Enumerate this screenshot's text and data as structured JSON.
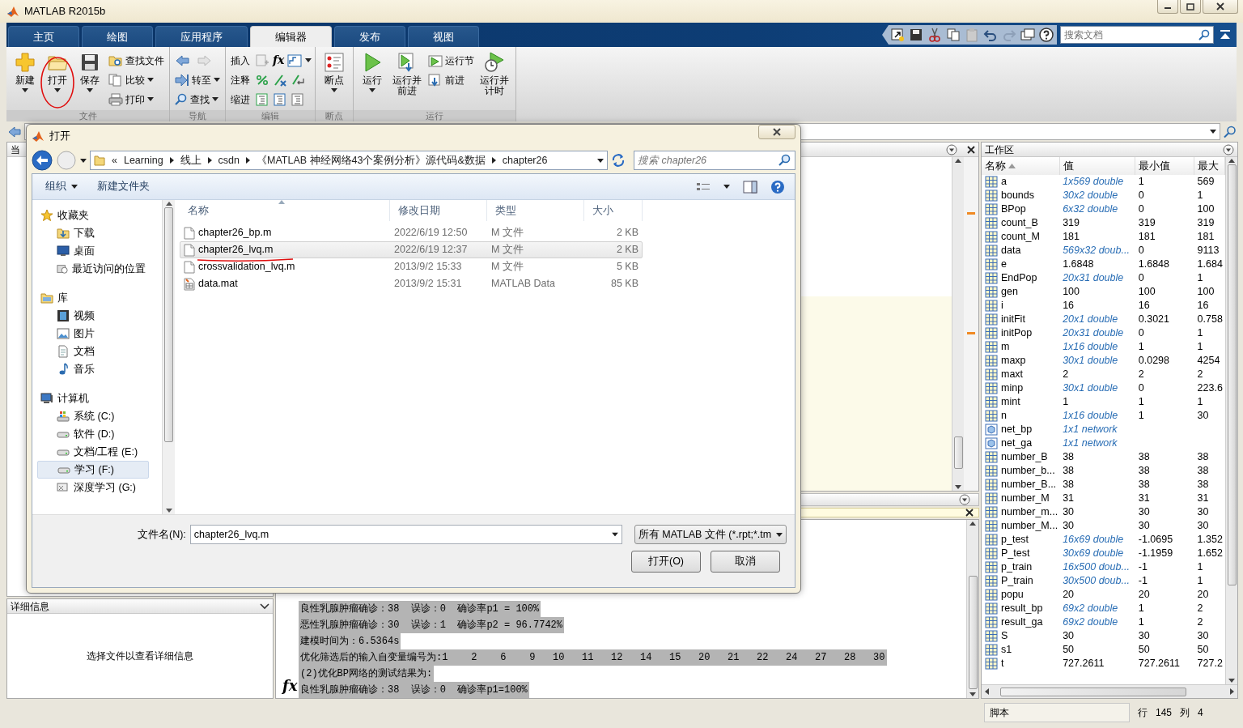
{
  "window": {
    "title": "MATLAB R2015b"
  },
  "tabs": [
    {
      "label": "主页",
      "selected": false
    },
    {
      "label": "绘图",
      "selected": false
    },
    {
      "label": "应用程序",
      "selected": false
    },
    {
      "label": "编辑器",
      "selected": true
    },
    {
      "label": "发布",
      "selected": false
    },
    {
      "label": "视图",
      "selected": false
    }
  ],
  "doc_search": {
    "placeholder": "搜索文档"
  },
  "ribbon": {
    "groups": [
      {
        "label": "文件",
        "items": [
          {
            "kind": "large",
            "label": "新建",
            "menu": true
          },
          {
            "kind": "large",
            "label": "打开",
            "menu": true
          },
          {
            "kind": "large",
            "label": "保存",
            "menu": true
          },
          {
            "kind": "small",
            "label": "查找文件",
            "menu": false
          },
          {
            "kind": "small",
            "label": "比较",
            "menu": true
          },
          {
            "kind": "small",
            "label": "打印",
            "menu": true
          }
        ]
      },
      {
        "label": "导航",
        "items": [
          {
            "kind": "small",
            "menu": false
          },
          {
            "kind": "small",
            "label": "转至",
            "menu": true
          },
          {
            "kind": "small",
            "label": "查找",
            "menu": true
          }
        ]
      },
      {
        "label": "编辑",
        "items": [
          {
            "kind": "small",
            "label": "插入",
            "glyph": "fx",
            "menu": true
          },
          {
            "kind": "small",
            "label": "注释",
            "menu": false
          },
          {
            "kind": "small",
            "label": "缩进",
            "menu": false
          }
        ]
      },
      {
        "label": "断点",
        "items": [
          {
            "kind": "large",
            "label": "断点",
            "menu": true
          }
        ]
      },
      {
        "label": "运行",
        "items": [
          {
            "kind": "large",
            "label": "运行",
            "menu": true
          },
          {
            "kind": "large",
            "label": "运行并前进",
            "menu": false
          },
          {
            "kind": "small",
            "label": "运行节",
            "menu": false
          },
          {
            "kind": "small",
            "label": "前进",
            "menu": false
          },
          {
            "kind": "large",
            "label": "运行并计时",
            "menu": false
          }
        ]
      }
    ]
  },
  "current_folder": {
    "title": "当"
  },
  "details": {
    "title": "详细信息",
    "message": "选择文件以查看详细信息"
  },
  "command_window": {
    "prompt_glyph": "fx",
    "lines": [
      {
        "text": "良性乳腺肿瘤确诊：38  误诊：0  确诊率p1 = 100%",
        "selected": true
      },
      {
        "text": "恶性乳腺肿瘤确诊：30  误诊：1  确诊率p2 = 96.7742%",
        "selected": true
      },
      {
        "text": "建模时间为：6.5364s",
        "selected": true
      },
      {
        "text": "优化筛选后的输入自变量编号为:1    2    6    9   10   11   12   14   15   20   21   22   24   27   28   30",
        "selected": true
      },
      {
        "text": "(2)优化BP网络的测试结果为:",
        "selected": true
      },
      {
        "text": "良性乳腺肿瘤确诊：38  误诊：0  确诊率p1=100%",
        "selected": true
      }
    ]
  },
  "workspace": {
    "title": "工作区",
    "columns": [
      {
        "label": "名称",
        "sorted": true
      },
      {
        "label": "值",
        "sorted": false
      },
      {
        "label": "最小值",
        "sorted": false
      },
      {
        "label": "最大",
        "sorted": false
      }
    ],
    "rows": [
      {
        "name": "a",
        "value": "1x569 double",
        "min": "1",
        "max": "569",
        "kind": "matrix"
      },
      {
        "name": "bounds",
        "value": "30x2 double",
        "min": "0",
        "max": "1",
        "kind": "matrix"
      },
      {
        "name": "BPop",
        "value": "6x32 double",
        "min": "0",
        "max": "100",
        "kind": "matrix"
      },
      {
        "name": "count_B",
        "value": "319",
        "min": "319",
        "max": "319",
        "kind": "scalar"
      },
      {
        "name": "count_M",
        "value": "181",
        "min": "181",
        "max": "181",
        "kind": "scalar"
      },
      {
        "name": "data",
        "value": "569x32 doub...",
        "min": "0",
        "max": "9113",
        "kind": "matrix"
      },
      {
        "name": "e",
        "value": "1.6848",
        "min": "1.6848",
        "max": "1.684",
        "kind": "scalar"
      },
      {
        "name": "EndPop",
        "value": "20x31 double",
        "min": "0",
        "max": "1",
        "kind": "matrix"
      },
      {
        "name": "gen",
        "value": "100",
        "min": "100",
        "max": "100",
        "kind": "scalar"
      },
      {
        "name": "i",
        "value": "16",
        "min": "16",
        "max": "16",
        "kind": "scalar"
      },
      {
        "name": "initFit",
        "value": "20x1 double",
        "min": "0.3021",
        "max": "0.758",
        "kind": "matrix"
      },
      {
        "name": "initPop",
        "value": "20x31 double",
        "min": "0",
        "max": "1",
        "kind": "matrix"
      },
      {
        "name": "m",
        "value": "1x16 double",
        "min": "1",
        "max": "1",
        "kind": "matrix"
      },
      {
        "name": "maxp",
        "value": "30x1 double",
        "min": "0.0298",
        "max": "4254",
        "kind": "matrix"
      },
      {
        "name": "maxt",
        "value": "2",
        "min": "2",
        "max": "2",
        "kind": "scalar"
      },
      {
        "name": "minp",
        "value": "30x1 double",
        "min": "0",
        "max": "223.6",
        "kind": "matrix"
      },
      {
        "name": "mint",
        "value": "1",
        "min": "1",
        "max": "1",
        "kind": "scalar"
      },
      {
        "name": "n",
        "value": "1x16 double",
        "min": "1",
        "max": "30",
        "kind": "matrix"
      },
      {
        "name": "net_bp",
        "value": "1x1 network",
        "kind": "object"
      },
      {
        "name": "net_ga",
        "value": "1x1 network",
        "kind": "object"
      },
      {
        "name": "number_B",
        "value": "38",
        "min": "38",
        "max": "38",
        "kind": "scalar"
      },
      {
        "name": "number_b...",
        "value": "38",
        "min": "38",
        "max": "38",
        "kind": "scalar"
      },
      {
        "name": "number_B...",
        "value": "38",
        "min": "38",
        "max": "38",
        "kind": "scalar"
      },
      {
        "name": "number_M",
        "value": "31",
        "min": "31",
        "max": "31",
        "kind": "scalar"
      },
      {
        "name": "number_m...",
        "value": "30",
        "min": "30",
        "max": "30",
        "kind": "scalar"
      },
      {
        "name": "number_M...",
        "value": "30",
        "min": "30",
        "max": "30",
        "kind": "scalar"
      },
      {
        "name": "p_test",
        "value": "16x69 double",
        "min": "-1.0695",
        "max": "1.352",
        "kind": "matrix"
      },
      {
        "name": "P_test",
        "value": "30x69 double",
        "min": "-1.1959",
        "max": "1.652",
        "kind": "matrix"
      },
      {
        "name": "p_train",
        "value": "16x500 doub...",
        "min": "-1",
        "max": "1",
        "kind": "matrix"
      },
      {
        "name": "P_train",
        "value": "30x500 doub...",
        "min": "-1",
        "max": "1",
        "kind": "matrix"
      },
      {
        "name": "popu",
        "value": "20",
        "min": "20",
        "max": "20",
        "kind": "scalar"
      },
      {
        "name": "result_bp",
        "value": "69x2 double",
        "min": "1",
        "max": "2",
        "kind": "matrix"
      },
      {
        "name": "result_ga",
        "value": "69x2 double",
        "min": "1",
        "max": "2",
        "kind": "matrix"
      },
      {
        "name": "S",
        "value": "30",
        "min": "30",
        "max": "30",
        "kind": "scalar"
      },
      {
        "name": "s1",
        "value": "50",
        "min": "50",
        "max": "50",
        "kind": "scalar"
      },
      {
        "name": "t",
        "value": "727.2611",
        "min": "727.2611",
        "max": "727.2",
        "kind": "scalar"
      }
    ]
  },
  "status_bar": {
    "mode": "脚本",
    "line_label": "行",
    "line": "145",
    "col_label": "列",
    "col": "4"
  },
  "dialog": {
    "title": "打开",
    "breadcrumb": [
      {
        "label": "«"
      },
      {
        "label": "Learning"
      },
      {
        "label": "线上"
      },
      {
        "label": "csdn"
      },
      {
        "label": "《MATLAB 神经网络43个案例分析》源代码&数据"
      },
      {
        "label": "chapter26"
      }
    ],
    "search": {
      "placeholder": "搜索 chapter26"
    },
    "toolbar": [
      {
        "label": "组织",
        "menu": true
      },
      {
        "label": "新建文件夹",
        "menu": false
      }
    ],
    "nav": [
      {
        "label": "收藏夹",
        "selected": false,
        "children": [
          {
            "label": "下载",
            "selected": false
          },
          {
            "label": "桌面",
            "selected": false
          },
          {
            "label": "最近访问的位置",
            "selected": false
          }
        ]
      },
      {
        "label": "库",
        "selected": false,
        "children": [
          {
            "label": "视频",
            "selected": false
          },
          {
            "label": "图片",
            "selected": false
          },
          {
            "label": "文档",
            "selected": false
          },
          {
            "label": "音乐",
            "selected": false
          }
        ]
      },
      {
        "label": "计算机",
        "selected": false,
        "children": [
          {
            "label": "系统 (C:)",
            "selected": false
          },
          {
            "label": "软件 (D:)",
            "selected": false
          },
          {
            "label": "文档/工程 (E:)",
            "selected": false
          },
          {
            "label": "学习 (F:)",
            "selected": true
          },
          {
            "label": "深度学习 (G:)",
            "selected": false
          }
        ]
      }
    ],
    "columns": [
      {
        "label": "名称",
        "sorted": true
      },
      {
        "label": "修改日期",
        "sorted": false
      },
      {
        "label": "类型",
        "sorted": false
      },
      {
        "label": "大小",
        "sorted": false
      }
    ],
    "files": [
      {
        "name": "chapter26_bp.m",
        "date": "2022/6/19 12:50",
        "type": "M 文件",
        "size": "2 KB",
        "kind": "m",
        "selected": false
      },
      {
        "name": "chapter26_lvq.m",
        "date": "2022/6/19 12:37",
        "type": "M 文件",
        "size": "2 KB",
        "kind": "m",
        "selected": true
      },
      {
        "name": "crossvalidation_lvq.m",
        "date": "2013/9/2 15:33",
        "type": "M 文件",
        "size": "5 KB",
        "kind": "m",
        "selected": false
      },
      {
        "name": "data.mat",
        "date": "2013/9/2 15:31",
        "type": "MATLAB Data",
        "size": "85 KB",
        "kind": "mat",
        "selected": false
      }
    ],
    "filename": {
      "label": "文件名(N):",
      "value": "chapter26_lvq.m"
    },
    "filter": {
      "value": "所有 MATLAB 文件 (*.rpt;*.tm"
    },
    "buttons": [
      {
        "label": "打开(O)"
      },
      {
        "label": "取消"
      }
    ]
  }
}
